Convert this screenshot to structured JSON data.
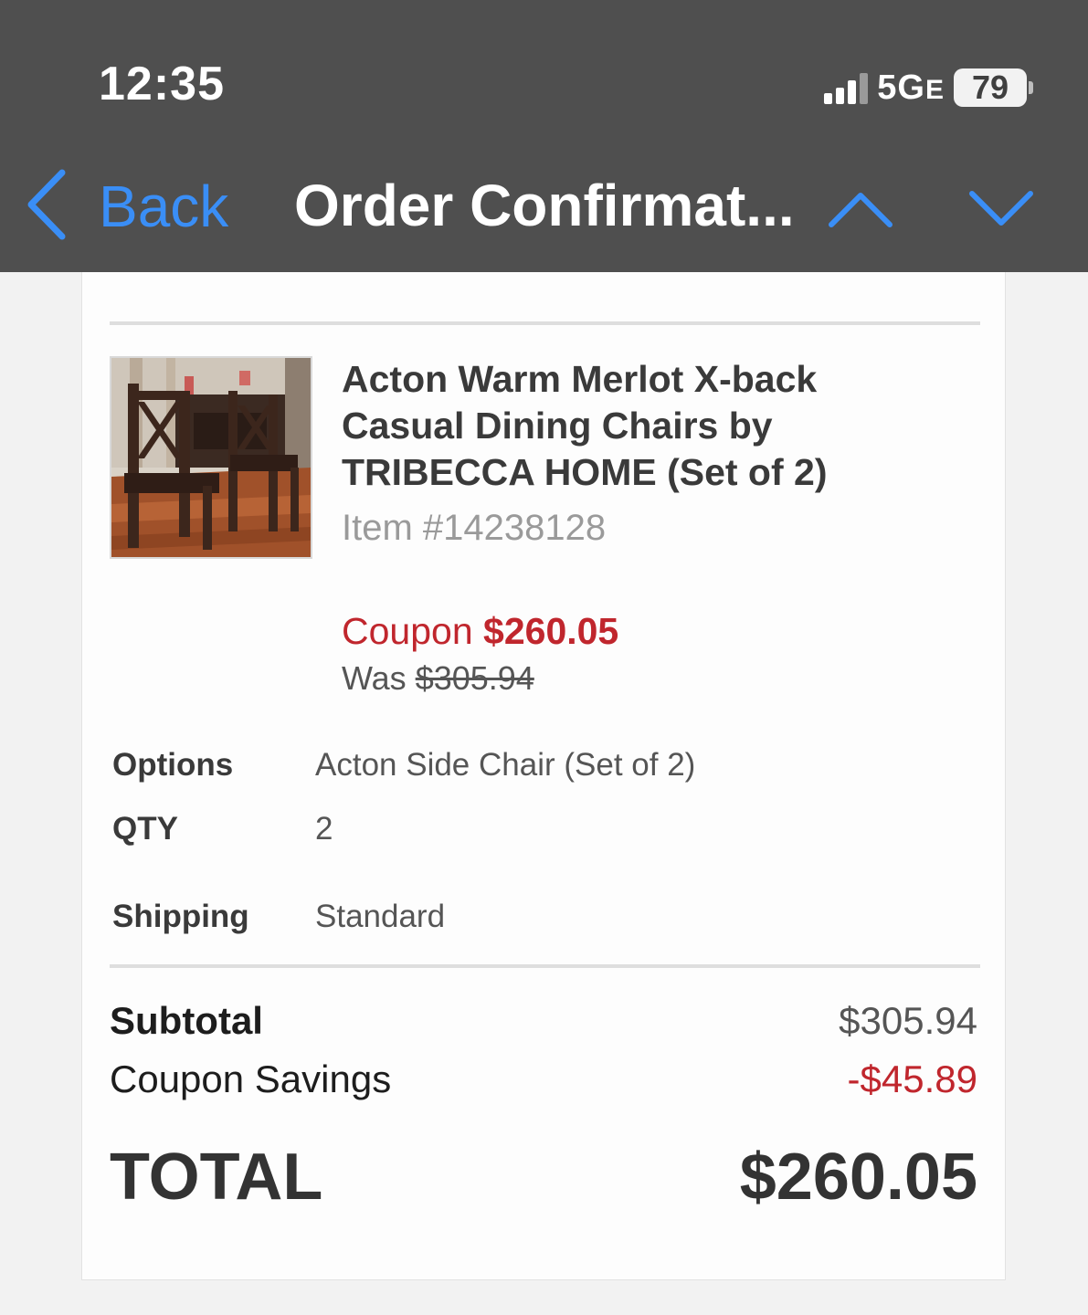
{
  "status_bar": {
    "time": "12:35",
    "network": "5G",
    "network_suffix": "E",
    "battery": "79"
  },
  "nav": {
    "back_label": "Back",
    "title": "Order Confirmat..."
  },
  "product": {
    "title": "Acton Warm Merlot X-back Casual Dining Chairs by TRIBECCA HOME (Set of 2)",
    "item_number": "Item #14238128",
    "coupon_label": "Coupon",
    "coupon_price": "$260.05",
    "was_label": "Was",
    "was_price": "$305.94"
  },
  "details": {
    "options_label": "Options",
    "options_value": "Acton Side Chair (Set of 2)",
    "qty_label": "QTY",
    "qty_value": "2",
    "shipping_label": "Shipping",
    "shipping_value": "Standard"
  },
  "summary": {
    "subtotal_label": "Subtotal",
    "subtotal_value": "$305.94",
    "coupon_savings_label": "Coupon Savings",
    "coupon_savings_value": "-$45.89",
    "total_label": "TOTAL",
    "total_value": "$260.05"
  },
  "colors": {
    "accent": "#3a8ef6",
    "sale_red": "#c0262d",
    "header_bg": "#4f4f4f"
  }
}
